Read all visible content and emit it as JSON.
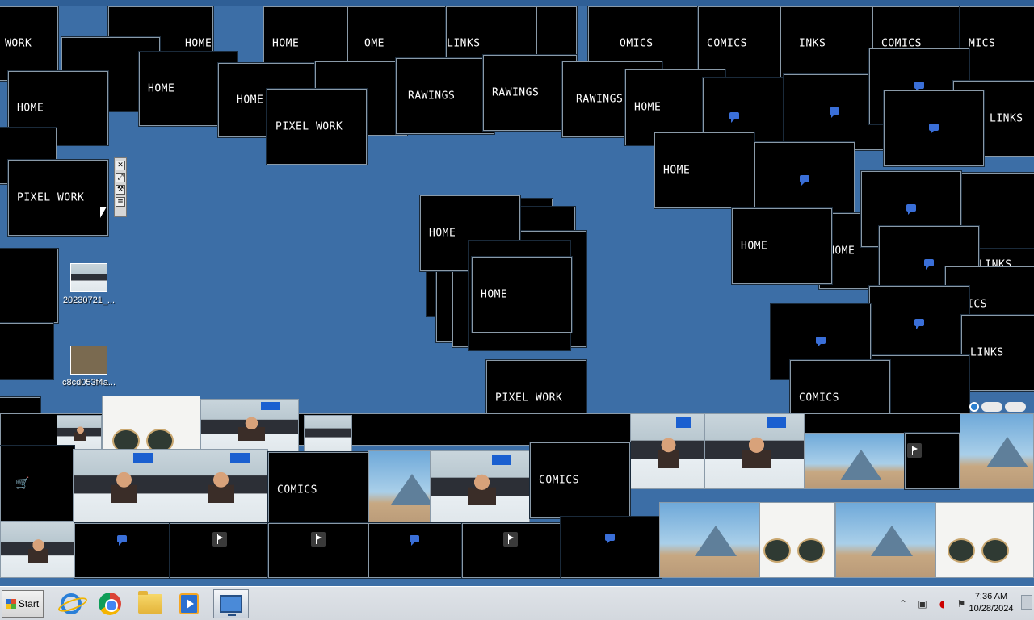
{
  "desktop": {
    "icons": [
      {
        "label": "20230721_..."
      },
      {
        "label": "c8cd053f4a..."
      }
    ],
    "tiles": [
      {
        "label": "WORK"
      },
      {
        "label": "HOME"
      },
      {
        "label": "HOME"
      },
      {
        "label": "HOME"
      },
      {
        "label": "HOME"
      },
      {
        "label": "OME"
      },
      {
        "label": "PIXEL WORK"
      },
      {
        "label": "RAWINGS"
      },
      {
        "label": "RAWINGS"
      },
      {
        "label": "RAWINGS"
      },
      {
        "label": "LINKS"
      },
      {
        "label": "OMICS"
      },
      {
        "label": "COMICS"
      },
      {
        "label": "INKS"
      },
      {
        "label": "COMICS"
      },
      {
        "label": "MICS"
      },
      {
        "label": "HOME"
      },
      {
        "label": "HOME"
      },
      {
        "label": "HOME"
      },
      {
        "label": "PIXEL WORK"
      },
      {
        "label": "HOME"
      },
      {
        "label": "HOME"
      },
      {
        "label": "HOME"
      },
      {
        "label": "PIXEL WORK"
      },
      {
        "label": "LINKS"
      },
      {
        "label": "LINKS"
      },
      {
        "label": "ICS"
      },
      {
        "label": "LINKS"
      },
      {
        "label": "COMICS"
      },
      {
        "label": "COMICS"
      },
      {
        "label": "COMICS"
      },
      {
        "label": "HOME"
      }
    ]
  },
  "taskbar": {
    "start_label": "Start",
    "apps": [
      {
        "icon": "internet-explorer-icon"
      },
      {
        "icon": "chrome-icon"
      },
      {
        "icon": "folder-icon"
      },
      {
        "icon": "media-player-icon"
      },
      {
        "icon": "remote-desktop-icon"
      }
    ],
    "clock_time": "7:36 AM",
    "clock_date": "10/28/2024"
  }
}
